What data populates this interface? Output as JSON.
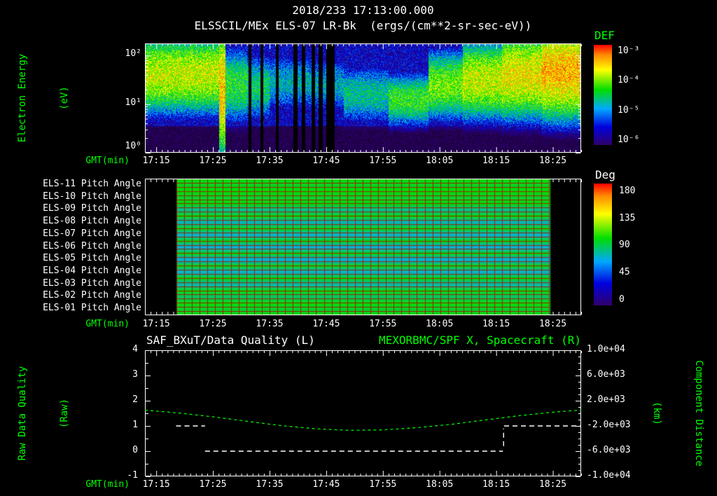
{
  "colors": {
    "background": "#000000",
    "text_primary": "#ffffff",
    "text_accent": "#00ff00",
    "grid_red": "#992200",
    "rainbow_stops": [
      "#30006a",
      "#0000dd",
      "#00a8ff",
      "#00dd00",
      "#ffff00",
      "#ff8800",
      "#ff0000"
    ],
    "rainbow_positions": [
      0,
      0.18,
      0.36,
      0.55,
      0.75,
      0.9,
      1.0
    ]
  },
  "header": {
    "datetime": "2018/233 17:13:00.000",
    "instrument_title": "ELSSCIL/MEx ELS-07 LR-Bk  (ergs/(cm**2-sr-sec-eV))"
  },
  "time_axis": {
    "label": "GMT(min)",
    "total_minutes": 77,
    "major_ticks": [
      {
        "minute": 2,
        "label": "17:15"
      },
      {
        "minute": 12,
        "label": "17:25"
      },
      {
        "minute": 22,
        "label": "17:35"
      },
      {
        "minute": 32,
        "label": "17:45"
      },
      {
        "minute": 42,
        "label": "17:55"
      },
      {
        "minute": 52,
        "label": "18:05"
      },
      {
        "minute": 62,
        "label": "18:15"
      },
      {
        "minute": 72,
        "label": "18:25"
      }
    ]
  },
  "spectrogram_panel": {
    "ylabel_line1": "Electron Energy",
    "ylabel_line2": "(eV)",
    "y_ticks": [
      {
        "exp": 2,
        "label": "10²"
      },
      {
        "exp": 1,
        "label": "10¹"
      },
      {
        "exp": 0,
        "label": "10⁰"
      }
    ],
    "colorbar": {
      "title": "DEF",
      "ticks": [
        "10⁻³",
        "10⁻⁴",
        "10⁻⁵",
        "10⁻⁶"
      ]
    }
  },
  "pitch_panel": {
    "row_labels": [
      "ELS-11 Pitch Angle",
      "ELS-10 Pitch Angle",
      "ELS-09 Pitch Angle",
      "ELS-08 Pitch Angle",
      "ELS-07 Pitch Angle",
      "ELS-06 Pitch Angle",
      "ELS-05 Pitch Angle",
      "ELS-04 Pitch Angle",
      "ELS-03 Pitch Angle",
      "ELS-02 Pitch Angle",
      "ELS-01 Pitch Angle"
    ],
    "colorbar": {
      "title": "Deg",
      "ticks": [
        "180",
        "135",
        "90",
        "45",
        "0"
      ]
    }
  },
  "quality_panel": {
    "title_left": "SAF_BXuT/Data Quality (L)",
    "title_right": "MEXORBMC/SPF X, Spacecraft (R)",
    "left_axis": {
      "label_line1": "Raw Data Quality",
      "label_line2": "(Raw)",
      "ticks": [
        "4",
        "3",
        "2",
        "1",
        "0",
        "-1"
      ]
    },
    "right_axis": {
      "label_line1": "Component Distance",
      "label_line2": "(km)",
      "ticks": [
        "1.0e+04",
        "6.0e+03",
        "2.0e+03",
        "-2.0e+03",
        "-6.0e+03",
        "-1.0e+04"
      ]
    }
  },
  "chart_data": [
    {
      "type": "heatmap",
      "title": "ELSSCIL/MEx ELS-07 LR-Bk (ergs/(cm**2-sr-sec-eV))",
      "xlabel": "GMT(min)",
      "ylabel": "Electron Energy (eV)",
      "x_start": "17:13:00",
      "x_end": "18:30:00",
      "x_tick_labels": [
        "17:15",
        "17:25",
        "17:35",
        "17:45",
        "17:55",
        "18:05",
        "18:15",
        "18:25"
      ],
      "y_scale": "log",
      "y_range_ev": [
        1,
        178
      ],
      "value_label": "DEF",
      "value_scale": "log",
      "value_range": [
        1e-06,
        0.001
      ],
      "background_log10_def": -5.6,
      "bands": [
        {
          "t0": 0,
          "t1": 13,
          "center_log10_ev": 1.62,
          "width": 0.5,
          "peak_log10_def": -3.85
        },
        {
          "t0": 13,
          "t1": 14.2,
          "center_log10_ev": 1.3,
          "width": 0.85,
          "peak_log10_def": -3.55
        },
        {
          "t0": 14.2,
          "t1": 18,
          "center_log10_ev": 1.4,
          "width": 0.5,
          "peak_log10_def": -4.35
        },
        {
          "t0": 18,
          "t1": 22,
          "center_log10_ev": 1.35,
          "width": 0.45,
          "peak_log10_def": -4.55
        },
        {
          "t0": 22,
          "t1": 29,
          "center_log10_ev": 1.45,
          "width": 0.4,
          "peak_log10_def": -4.8
        },
        {
          "t0": 29,
          "t1": 35,
          "center_log10_ev": 1.4,
          "width": 0.4,
          "peak_log10_def": -4.85
        },
        {
          "t0": 35,
          "t1": 43,
          "center_log10_ev": 1.2,
          "width": 0.4,
          "peak_log10_def": -4.65
        },
        {
          "t0": 43,
          "t1": 50,
          "center_log10_ev": 1.1,
          "width": 0.35,
          "peak_log10_def": -4.3
        },
        {
          "t0": 50,
          "t1": 56,
          "center_log10_ev": 1.4,
          "width": 0.45,
          "peak_log10_def": -4.1
        },
        {
          "t0": 56,
          "t1": 63,
          "center_log10_ev": 1.5,
          "width": 0.5,
          "peak_log10_def": -3.85
        },
        {
          "t0": 63,
          "t1": 70,
          "center_log10_ev": 1.6,
          "width": 0.55,
          "peak_log10_def": -3.7
        },
        {
          "t0": 70,
          "t1": 77.1,
          "center_log10_ev": 1.68,
          "width": 0.6,
          "peak_log10_def": -3.5
        }
      ],
      "data_gaps_min": [
        [
          18.2,
          18.7
        ],
        [
          20.3,
          20.8
        ],
        [
          23.1,
          23.6
        ],
        [
          26.2,
          26.9
        ],
        [
          27.6,
          28.2
        ],
        [
          29.3,
          30.0
        ],
        [
          30.6,
          31.3
        ],
        [
          31.9,
          33.4
        ]
      ]
    },
    {
      "type": "heatmap",
      "rows": [
        "ELS-11",
        "ELS-10",
        "ELS-09",
        "ELS-08",
        "ELS-07",
        "ELS-06",
        "ELS-05",
        "ELS-04",
        "ELS-03",
        "ELS-02",
        "ELS-01"
      ],
      "value_label": "Pitch Angle (Deg)",
      "value_range_deg": [
        0,
        180
      ],
      "data_window_min": [
        5.6,
        71.4
      ],
      "row_edge_deg": 100,
      "row_center_deg": [
        95,
        93,
        80,
        74,
        72,
        70,
        70,
        72,
        76,
        86,
        93
      ],
      "x_tick_labels": [
        "17:15",
        "17:25",
        "17:35",
        "17:45",
        "17:55",
        "18:05",
        "18:15",
        "18:25"
      ]
    },
    {
      "type": "line",
      "title_left": "SAF_BXuT/Data Quality (L)",
      "title_right": "MEXORBMC/SPF X, Spacecraft (R)",
      "xlabel": "GMT(min)",
      "x_tick_labels": [
        "17:15",
        "17:25",
        "17:35",
        "17:45",
        "17:55",
        "18:05",
        "18:15",
        "18:25"
      ],
      "left_axis": {
        "label": "Raw Data Quality (Raw)",
        "range": [
          -1,
          4
        ]
      },
      "right_axis": {
        "label": "Component Distance (km)",
        "range": [
          -10000,
          10000
        ]
      },
      "series": [
        {
          "name": "SAF_BXuT/Data Quality",
          "axis": "left",
          "color": "#ffffff",
          "line_style": "dashed",
          "segments": [
            [
              [
                5.5,
                1
              ],
              [
                10.6,
                1
              ]
            ],
            [
              [
                10.6,
                0
              ],
              [
                63.2,
                0
              ]
            ],
            [
              [
                63.3,
                0.2
              ],
              [
                63.3,
                0.9
              ]
            ],
            [
              [
                63.4,
                1
              ],
              [
                77,
                1
              ]
            ]
          ]
        },
        {
          "name": "MEXORBMC/SPF X, Spacecraft",
          "axis": "right",
          "color": "#00ff00",
          "line_style": "dashed",
          "points": [
            [
              0,
              500
            ],
            [
              6,
              60
            ],
            [
              12,
              -560
            ],
            [
              18,
              -1250
            ],
            [
              24,
              -1950
            ],
            [
              30,
              -2450
            ],
            [
              36,
              -2700
            ],
            [
              42,
              -2620
            ],
            [
              48,
              -2280
            ],
            [
              54,
              -1750
            ],
            [
              60,
              -1060
            ],
            [
              66,
              -380
            ],
            [
              72,
              180
            ],
            [
              77,
              520
            ]
          ]
        }
      ]
    }
  ]
}
